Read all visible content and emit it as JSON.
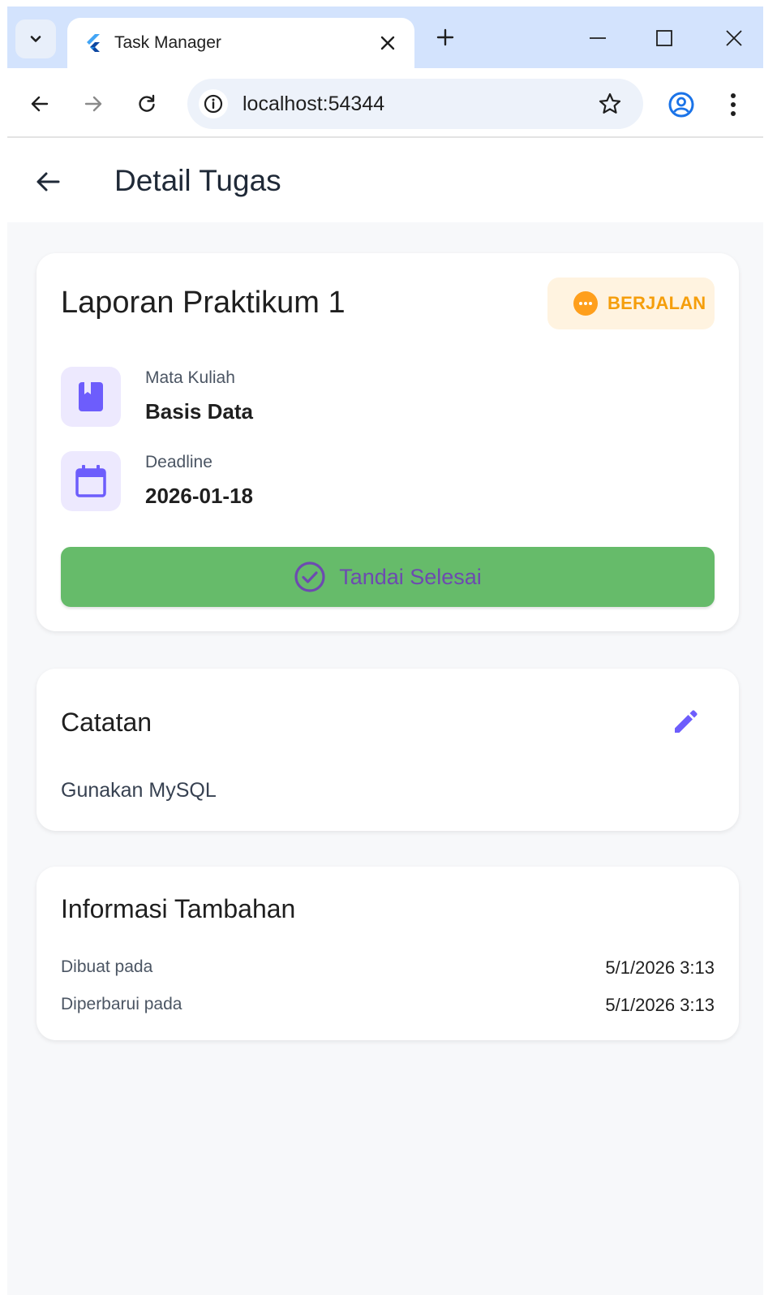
{
  "browser": {
    "tab_title": "Task Manager",
    "url": "localhost:54344"
  },
  "appbar": {
    "title": "Detail Tugas"
  },
  "task": {
    "title": "Laporan Praktikum 1",
    "status": "BERJALAN",
    "status_color": "#f59e0b",
    "course_label": "Mata Kuliah",
    "course_value": "Basis Data",
    "deadline_label": "Deadline",
    "deadline_value": "2026-01-18",
    "done_button_label": "Tandai Selesai",
    "done_button_color": "#66bb6a",
    "accent_color": "#6d5dfc"
  },
  "notes": {
    "title": "Catatan",
    "text": "Gunakan MySQL"
  },
  "info": {
    "title": "Informasi Tambahan",
    "rows": [
      {
        "label": "Dibuat pada",
        "value": "5/1/2026 3:13"
      },
      {
        "label": "Diperbarui pada",
        "value": "5/1/2026 3:13"
      }
    ]
  },
  "icons": {
    "tab_search": "chevron-down-icon",
    "tab_logo": "flutter-icon",
    "tab_close": "close-icon",
    "new_tab": "plus-icon",
    "minimize": "minimize-icon",
    "maximize": "maximize-icon",
    "close_window": "close-icon",
    "back": "arrow-left-icon",
    "forward": "arrow-right-icon",
    "reload": "reload-icon",
    "site_info": "info-icon",
    "bookmark": "star-icon",
    "profile": "account-icon",
    "menu": "more-vert-icon",
    "course": "book-icon",
    "deadline": "calendar-icon",
    "done": "check-circle-icon",
    "edit": "pencil-icon"
  }
}
